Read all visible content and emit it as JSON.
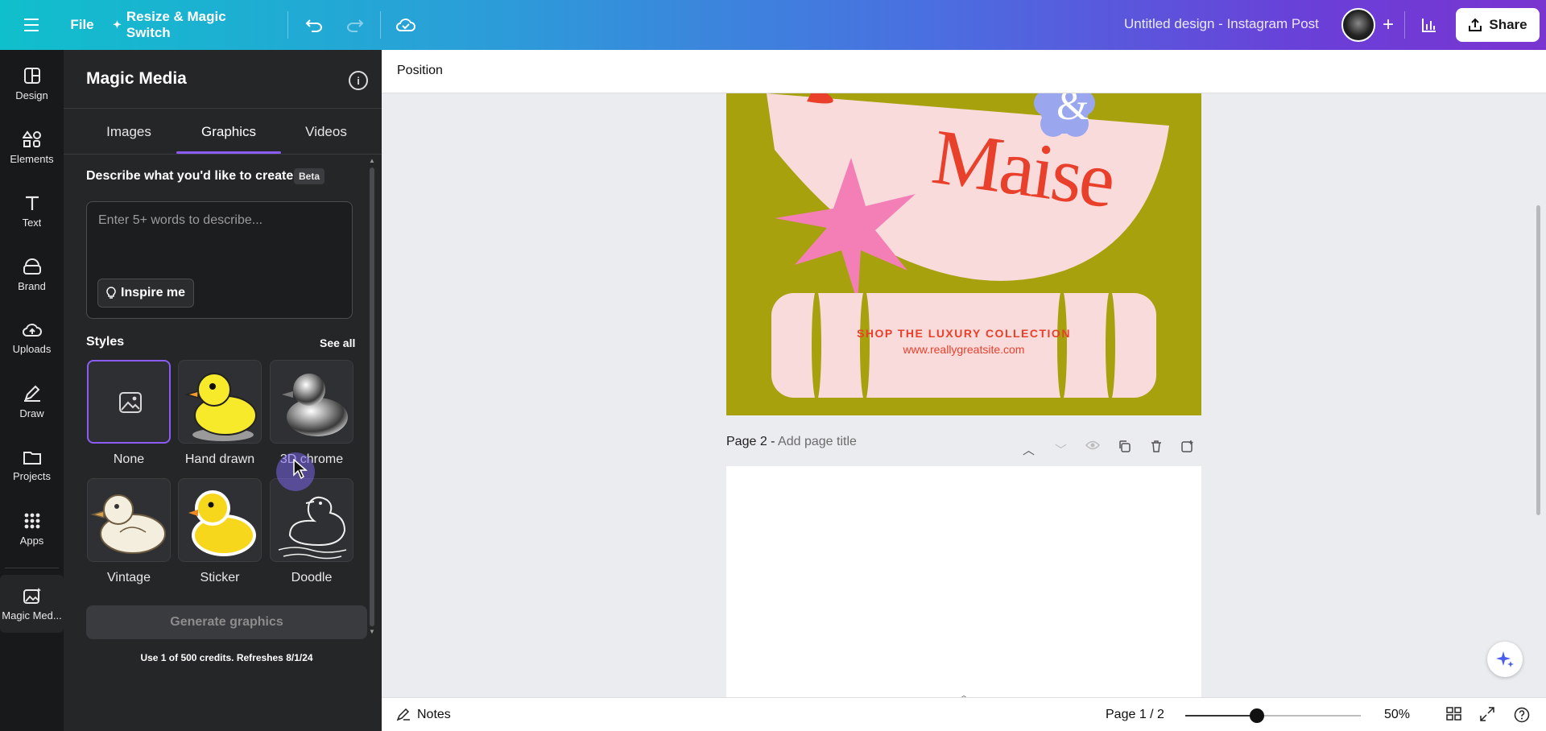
{
  "topbar": {
    "file": "File",
    "resize": "Resize & Magic Switch",
    "doc_title": "Untitled design - Instagram Post",
    "share": "Share"
  },
  "rail": {
    "items": [
      {
        "label": "Design",
        "icon": "layout-icon"
      },
      {
        "label": "Elements",
        "icon": "shapes-icon"
      },
      {
        "label": "Text",
        "icon": "text-icon"
      },
      {
        "label": "Brand",
        "icon": "brand-icon"
      },
      {
        "label": "Uploads",
        "icon": "cloud-upload-icon"
      },
      {
        "label": "Draw",
        "icon": "pen-icon"
      },
      {
        "label": "Projects",
        "icon": "folder-icon"
      },
      {
        "label": "Apps",
        "icon": "apps-grid-icon"
      },
      {
        "label": "Magic Med...",
        "icon": "magic-media-icon"
      }
    ]
  },
  "panel": {
    "title": "Magic Media",
    "tabs": [
      "Images",
      "Graphics",
      "Videos"
    ],
    "active_tab": "Graphics",
    "describe_label": "Describe what you'd like to create",
    "beta": "Beta",
    "prompt_placeholder": "Enter 5+ words to describe...",
    "inspire": "Inspire me",
    "styles_label": "Styles",
    "see_all": "See all",
    "styles": [
      {
        "name": "None",
        "selected": true
      },
      {
        "name": "Hand drawn",
        "selected": false
      },
      {
        "name": "3D chrome",
        "selected": false
      },
      {
        "name": "Vintage",
        "selected": false
      },
      {
        "name": "Sticker",
        "selected": false
      },
      {
        "name": "Doodle",
        "selected": false
      }
    ],
    "generate": "Generate graphics",
    "credits": "Use 1 of 500 credits. Refreshes 8/1/24"
  },
  "toolbar": {
    "position": "Position"
  },
  "canvas": {
    "brand_text": "Maise",
    "ampersand": "&",
    "shop_text": "SHOP THE LUXURY COLLECTION",
    "url_text": "www.reallygreatsite.com",
    "page2_prefix": "Page 2 - ",
    "page2_placeholder": "Add page title",
    "accent_color": "#e8402a",
    "bg_color": "#a6a10d"
  },
  "bottombar": {
    "notes": "Notes",
    "page_indicator": "Page 1 / 2",
    "zoom": "50%"
  }
}
